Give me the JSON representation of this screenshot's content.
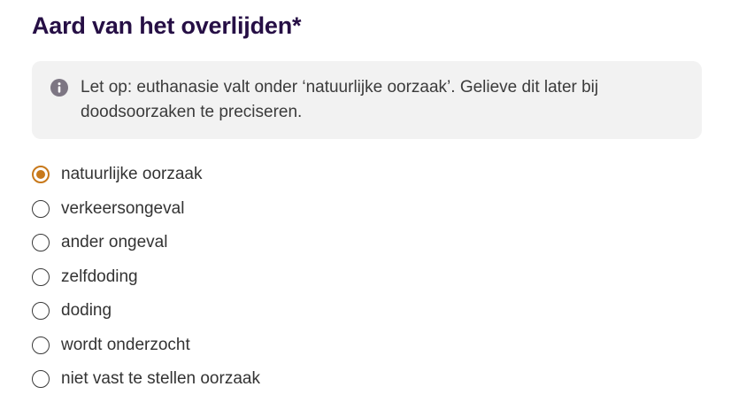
{
  "question": {
    "title": "Aard van het overlijden*"
  },
  "info": {
    "icon": "info-icon",
    "text": "Let op: euthanasie valt onder ‘natuurlijke oorzaak’. Gelieve dit later bij doodsoorzaken te preciseren."
  },
  "options": [
    {
      "label": "natuurlijke oorzaak",
      "selected": true
    },
    {
      "label": "verkeersongeval",
      "selected": false
    },
    {
      "label": "ander ongeval",
      "selected": false
    },
    {
      "label": "zelfdoding",
      "selected": false
    },
    {
      "label": "doding",
      "selected": false
    },
    {
      "label": "wordt onderzocht",
      "selected": false
    },
    {
      "label": "niet vast te stellen oorzaak",
      "selected": false
    }
  ],
  "colors": {
    "title": "#260f45",
    "accent": "#c8791b",
    "info_background": "#f2f2f2",
    "info_icon": "#7d7683"
  }
}
